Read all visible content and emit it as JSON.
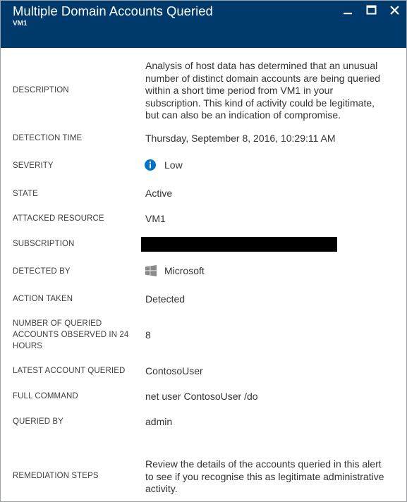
{
  "window": {
    "title": "Multiple Domain Accounts Queried",
    "subtitle": "VM1"
  },
  "fields": {
    "description": {
      "label": "DESCRIPTION",
      "value": "Analysis of host data has determined that an unusual number of distinct domain accounts are being queried within a short time period from VM1 in your subscription. This kind of activity could be legitimate, but can also be an indication of compromise."
    },
    "detection_time": {
      "label": "DETECTION TIME",
      "value": "Thursday, September 8, 2016, 10:29:11 AM"
    },
    "severity": {
      "label": "SEVERITY",
      "value": "Low",
      "icon": "info-icon"
    },
    "state": {
      "label": "STATE",
      "value": "Active"
    },
    "attacked_resource": {
      "label": "ATTACKED RESOURCE",
      "value": "VM1"
    },
    "subscription": {
      "label": "SUBSCRIPTION"
    },
    "detected_by": {
      "label": "DETECTED BY",
      "value": "Microsoft",
      "icon": "windows-logo-icon"
    },
    "action_taken": {
      "label": "ACTION TAKEN",
      "value": "Detected"
    },
    "num_accounts": {
      "label": "NUMBER OF QUERIED ACCOUNTS OBSERVED IN 24 HOURS",
      "value": "8"
    },
    "latest_account": {
      "label": "LATEST ACCOUNT QUERIED",
      "value": "ContosoUser"
    },
    "full_command": {
      "label": "FULL COMMAND",
      "value": "net user ContosoUser /do"
    },
    "queried_by": {
      "label": "QUERIED BY",
      "value": "admin"
    },
    "remediation": {
      "label": "REMEDIATION STEPS",
      "value": "Review the details of the accounts queried in this alert to see if you recognise this as legitimate administrative activity."
    }
  },
  "colors": {
    "header_bg": "#003a6c",
    "info_blue": "#0072c6"
  }
}
